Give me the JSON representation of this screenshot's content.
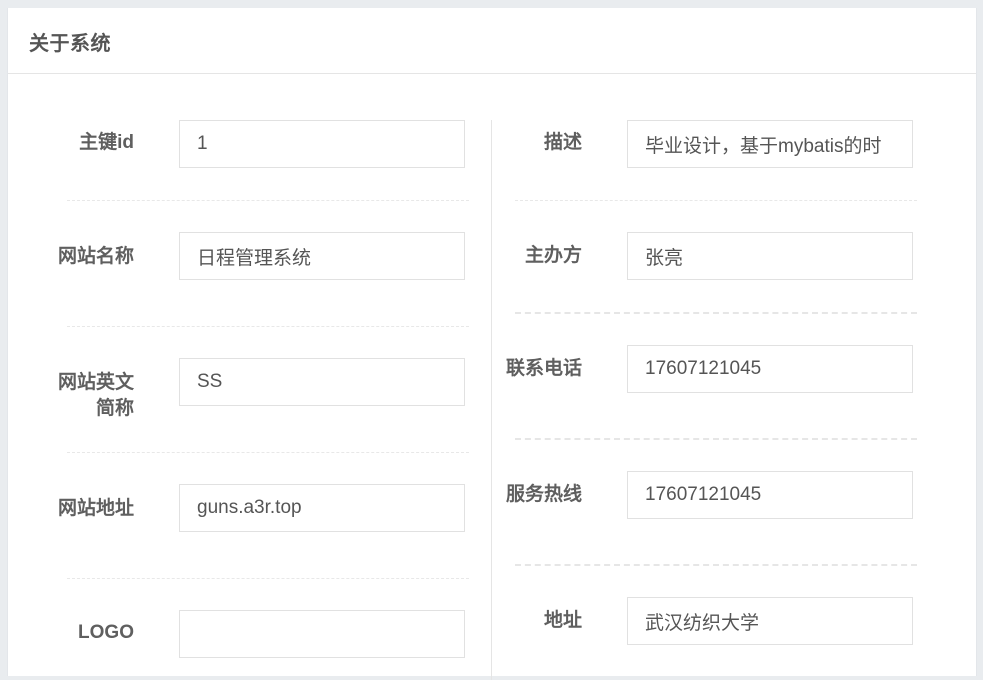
{
  "panel": {
    "title": "关于系统"
  },
  "left_fields": [
    {
      "label": "主键id",
      "value": "1"
    },
    {
      "label": "网站名称",
      "value": "日程管理系统"
    },
    {
      "label": "网站英文简称",
      "value": "SS"
    },
    {
      "label": "网站地址",
      "value": "guns.a3r.top"
    },
    {
      "label": "LOGO",
      "value": ""
    }
  ],
  "right_fields": [
    {
      "label": "描述",
      "value": "毕业设计，基于mybatis的时"
    },
    {
      "label": "主办方",
      "value": "张亮"
    },
    {
      "label": "联系电话",
      "value": "17607121045"
    },
    {
      "label": "服务热线",
      "value": "17607121045"
    },
    {
      "label": "地址",
      "value": "武汉纺织大学"
    }
  ]
}
